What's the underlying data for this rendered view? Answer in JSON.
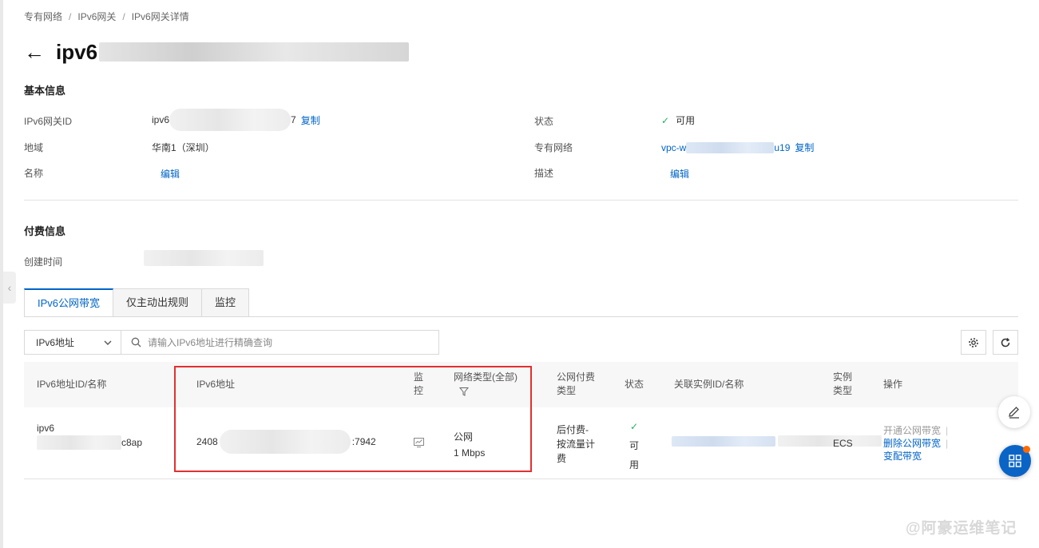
{
  "breadcrumb": {
    "item1": "专有网络",
    "item2": "IPv6网关",
    "item3": "IPv6网关详情",
    "sep": "/"
  },
  "header": {
    "back_icon": "←",
    "title": "ipv6"
  },
  "basic": {
    "section_title": "基本信息",
    "gateway_id_label": "IPv6网关ID",
    "gateway_id_prefix": "ipv6",
    "gateway_id_suffix": "7",
    "copy_label": "复制",
    "status_label": "状态",
    "status_value": "可用",
    "region_label": "地域",
    "region_value": "华南1（深圳）",
    "vpc_label": "专有网络",
    "vpc_prefix": "vpc-w",
    "vpc_suffix": "u19",
    "name_label": "名称",
    "edit_label": "编辑",
    "desc_label": "描述"
  },
  "billing": {
    "section_title": "付费信息",
    "created_label": "创建时间"
  },
  "tabs": [
    {
      "label": "IPv6公网带宽",
      "active": true
    },
    {
      "label": "仅主动出规则",
      "active": false
    },
    {
      "label": "监控",
      "active": false
    }
  ],
  "search": {
    "select_value": "IPv6地址",
    "placeholder": "请输入IPv6地址进行精确查询"
  },
  "table": {
    "headers": {
      "id_name": "IPv6地址ID/名称",
      "ipv6_addr": "IPv6地址",
      "monitor_1": "监",
      "monitor_2": "控",
      "net_type": "网络类型(全部)",
      "pay_type_1": "公网付费",
      "pay_type_2": "类型",
      "status": "状态",
      "instance": "关联实例ID/名称",
      "inst_type_1": "实例",
      "inst_type_2": "类型",
      "ops": "操作"
    },
    "row": {
      "id_prefix": "ipv6",
      "id_suffix": "c8ap",
      "addr_prefix": "2408",
      "addr_suffix": ":7942",
      "net_type": "公网",
      "bandwidth": "1 Mbps",
      "pay_1": "后付费-",
      "pay_2": "按流量计",
      "pay_3": "费",
      "status_1": "可",
      "status_2": "用",
      "inst_type": "ECS",
      "op_open": "开通公网带宽",
      "op_delete": "删除公网带宽",
      "op_change": "变配带宽"
    }
  },
  "watermark": "@阿豪运维笔记",
  "colors": {
    "accent": "#0064c8",
    "success": "#23b066",
    "highlight": "#e23030",
    "fab": "#0a64c6"
  }
}
